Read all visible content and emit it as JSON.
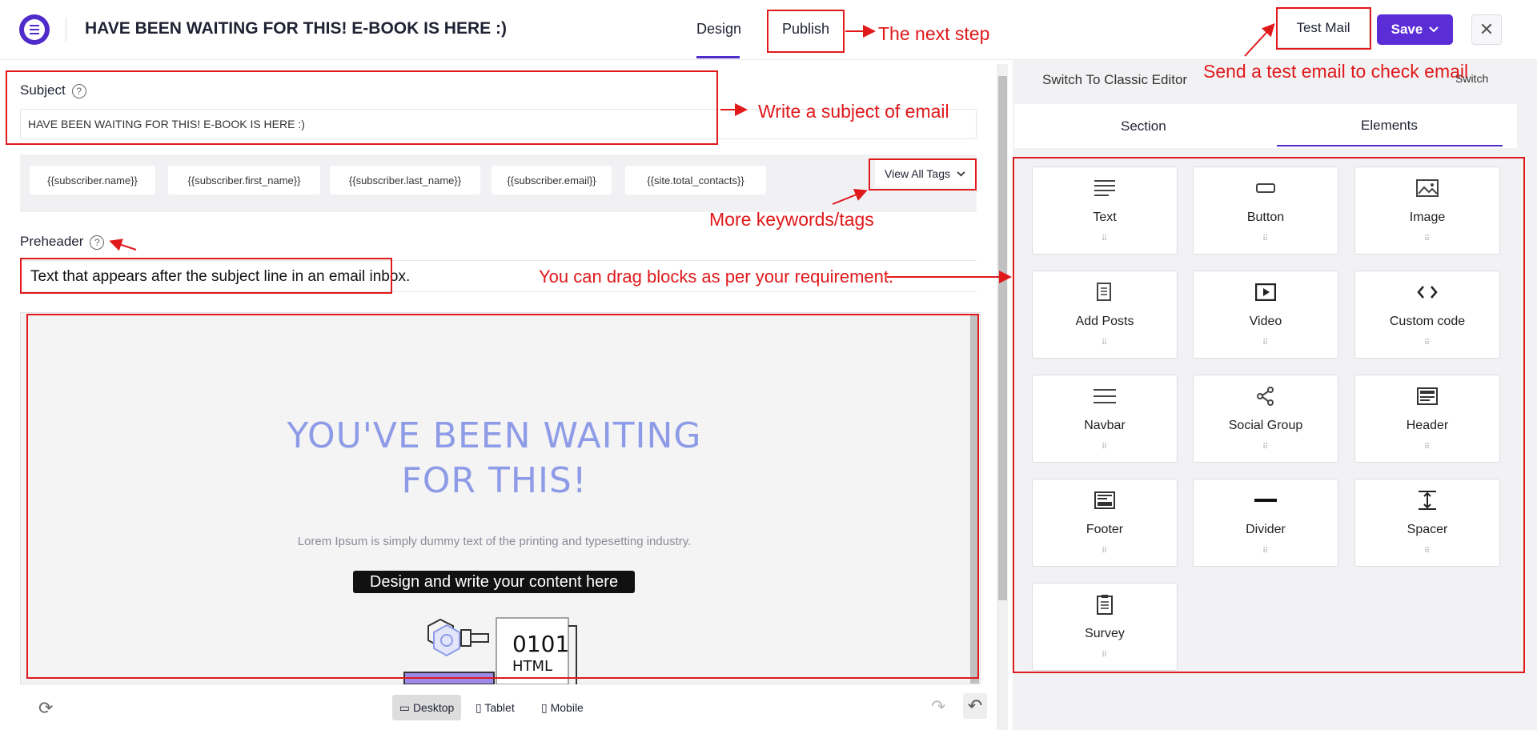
{
  "header": {
    "title": "HAVE BEEN WAITING FOR THIS! E-BOOK IS HERE :)",
    "tabs": [
      "Design",
      "Publish"
    ],
    "test_mail": "Test Mail",
    "save": "Save",
    "close": "✕"
  },
  "editor": {
    "subject_label": "Subject",
    "subject_value": "HAVE BEEN WAITING FOR THIS! E-BOOK IS HERE :)",
    "tags": [
      "{{subscriber.name}}",
      "{{subscriber.first_name}}",
      "{{subscriber.last_name}}",
      "{{subscriber.email}}",
      "{{site.total_contacts}}"
    ],
    "view_all_tags": "View All Tags",
    "preheader_label": "Preheader",
    "preheader_text": "Text that appears after the subject line in an email inbox."
  },
  "canvas": {
    "hero_line1": "YOU'VE BEEN WAITING",
    "hero_line2": "FOR THIS!",
    "lorem": "Lorem Ipsum is simply dummy text of the printing and typesetting industry.",
    "design_tip": "Design and write your content here",
    "illustration_text1": "0101",
    "illustration_text2": "HTML"
  },
  "devices": {
    "desktop": "Desktop",
    "tablet": "Tablet",
    "mobile": "Mobile"
  },
  "panel": {
    "switch_label": "Switch To Classic Editor",
    "switch_small": "Switch",
    "tab_section": "Section",
    "tab_elements": "Elements",
    "elements": [
      "Text",
      "Button",
      "Image",
      "Add Posts",
      "Video",
      "Custom code",
      "Navbar",
      "Social Group",
      "Header",
      "Footer",
      "Divider",
      "Spacer",
      "Survey"
    ]
  },
  "annotations": {
    "next_step": "The next step",
    "test_email": "Send a test email to check email",
    "subject": "Write a subject of email",
    "keywords": "More keywords/tags",
    "drag": "You can drag blocks as per your requirement."
  },
  "colors": {
    "accent": "#4f2bc9",
    "annotation": "#e0191b",
    "hero": "#8e9be6"
  }
}
